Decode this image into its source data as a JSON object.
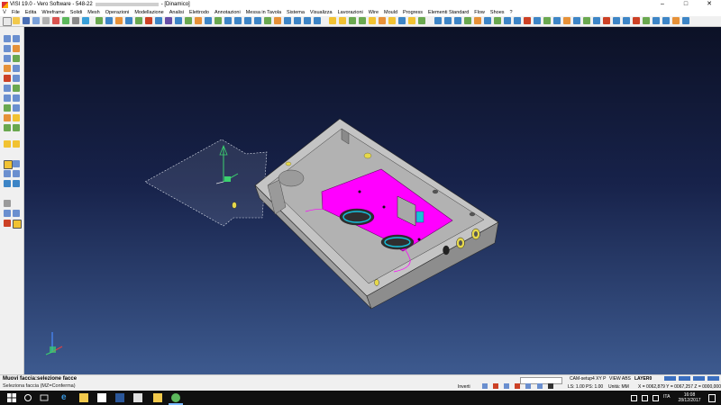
{
  "window": {
    "title": "VISI 19.0 - Vero Software - 548-22",
    "title_suffix": "- [Dinamico]",
    "controls": [
      "–",
      "□",
      "✕"
    ]
  },
  "menu": [
    "File",
    "Edita",
    "Wireframe",
    "Solidi",
    "Mesh",
    "Operazioni",
    "Modellazione",
    "Analisi",
    "Elettrodo",
    "Annotazioni",
    "Messa in Tavola",
    "Sistema",
    "Visualizza",
    "Lavorazioni",
    "Wire",
    "Mould",
    "Progress",
    "Elementi Standard",
    "Flow",
    "Shoes",
    "?"
  ],
  "status": {
    "title": "Muovi faccia:selezione facce",
    "prompt": "Seleziona faccia (MZ=Conferma)",
    "inverti": "Inverti",
    "setup": "CAM-setup4 XY P",
    "view": "VIEW ABS",
    "layer": "LAYER0",
    "ls_ps": "LS: 1.00 PS: 1.00",
    "units": "Unità: MM",
    "coords": "X = 0062,879 Y = 0067,257 Z = 0000,000"
  },
  "taskbar": {
    "time": "16:08",
    "date": "28/12/2017",
    "lang": "ITA"
  },
  "icons": [
    "windows-start-icon",
    "search-icon",
    "task-view-icon",
    "edge-icon",
    "file-explorer-icon",
    "store-icon",
    "word-icon",
    "excel-icon",
    "mail-icon",
    "folder-icon",
    "visi-icon"
  ],
  "colors": {
    "viewport_top": "#0c1126",
    "viewport_bottom": "#3d5a8f",
    "part_body": "#a9a9a9",
    "selected_face": "#ff00ff",
    "hole_accent": "#e6d84a"
  }
}
